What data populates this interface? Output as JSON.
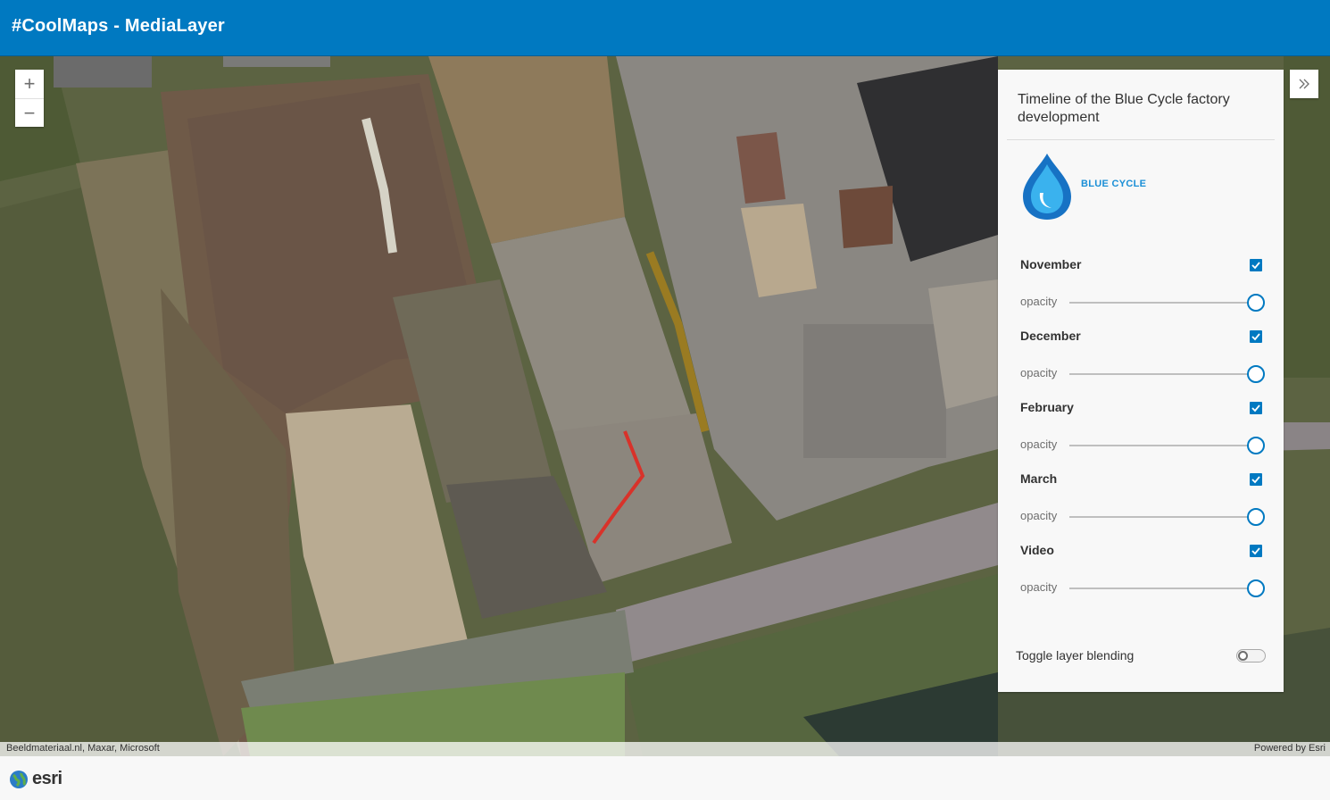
{
  "header": {
    "title": "#CoolMaps - MediaLayer",
    "color": "#0079c1"
  },
  "map": {
    "zoom_in_label": "+",
    "zoom_out_label": "−",
    "attribution": "Beeldmateriaal.nl, Maxar, Microsoft",
    "powered_by": "Powered by Esri"
  },
  "panel": {
    "title": "Timeline of the Blue Cycle factory development",
    "logo_text": "BLUE CYCLE",
    "opacity_label": "opacity",
    "layers": [
      {
        "label": "November",
        "checked": true,
        "opacity": 1.0
      },
      {
        "label": "December",
        "checked": true,
        "opacity": 1.0
      },
      {
        "label": "February",
        "checked": true,
        "opacity": 1.0
      },
      {
        "label": "March",
        "checked": true,
        "opacity": 1.0
      },
      {
        "label": "Video",
        "checked": true,
        "opacity": 1.0
      }
    ],
    "blend_label": "Toggle layer blending",
    "blend_on": false
  },
  "footer": {
    "brand": "esri"
  },
  "icons": {
    "expand": "double-chevron-right-icon",
    "checkbox": "checkmark-icon",
    "globe": "globe-icon"
  }
}
